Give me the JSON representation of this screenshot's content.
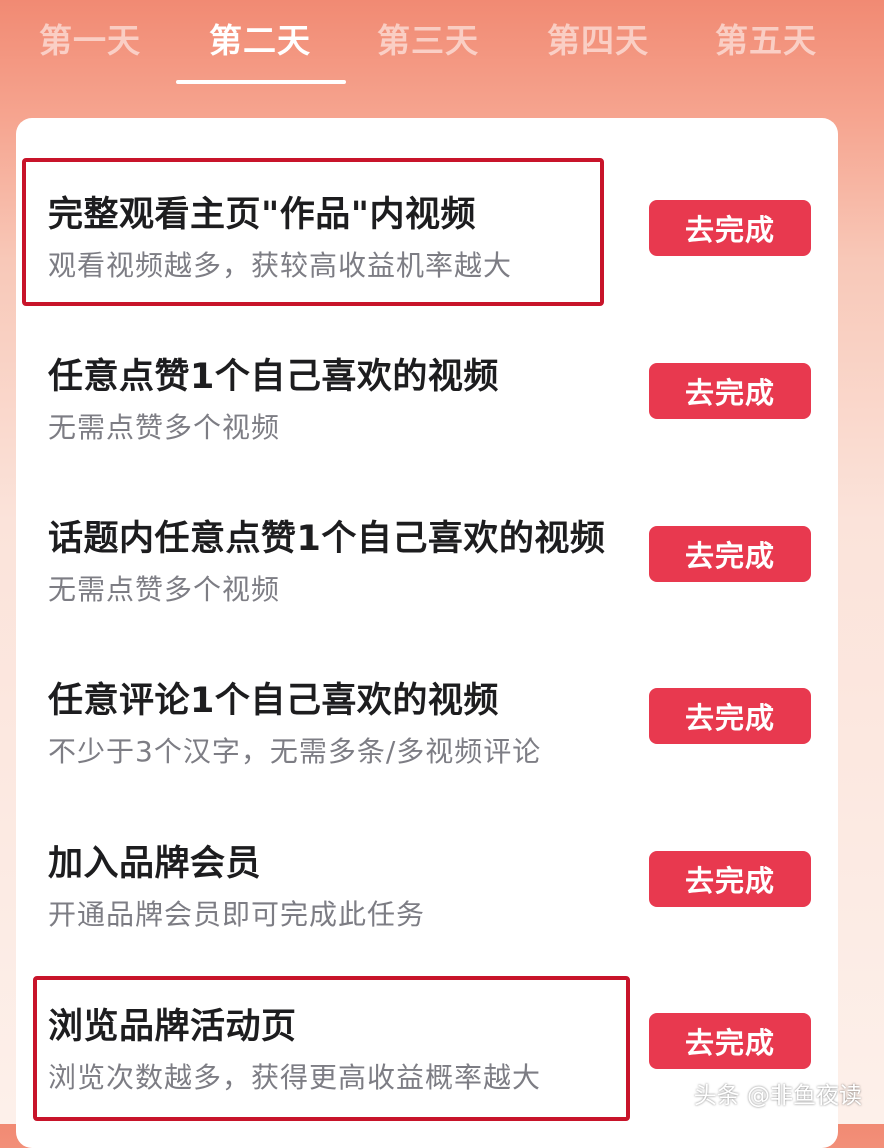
{
  "tabs": [
    {
      "label": "第一天"
    },
    {
      "label": "第二天"
    },
    {
      "label": "第三天"
    },
    {
      "label": "第四天"
    },
    {
      "label": "第五天"
    }
  ],
  "active_tab": "第二天",
  "tasks": [
    {
      "title": "完整观看主页\"作品\"内视频",
      "subtitle": "观看视频越多，获较高收益机率越大",
      "button": "去完成"
    },
    {
      "title": "任意点赞1个自己喜欢的视频",
      "subtitle": "无需点赞多个视频",
      "button": "去完成"
    },
    {
      "title": "话题内任意点赞1个自己喜欢的视频",
      "subtitle": "无需点赞多个视频",
      "button": "去完成"
    },
    {
      "title": "任意评论1个自己喜欢的视频",
      "subtitle": "不少于3个汉字，无需多条/多视频评论",
      "button": "去完成"
    },
    {
      "title": "加入品牌会员",
      "subtitle": "开通品牌会员即可完成此任务",
      "button": "去完成"
    },
    {
      "title": "浏览品牌活动页",
      "subtitle": "浏览次数越多，获得更高收益概率越大",
      "button": "去完成"
    }
  ],
  "watermark": "头条 @非鱼夜读",
  "colors": {
    "accent_button": "#e8394f",
    "highlight_border": "#c8142a",
    "header_gradient_top": "#f18a73"
  }
}
